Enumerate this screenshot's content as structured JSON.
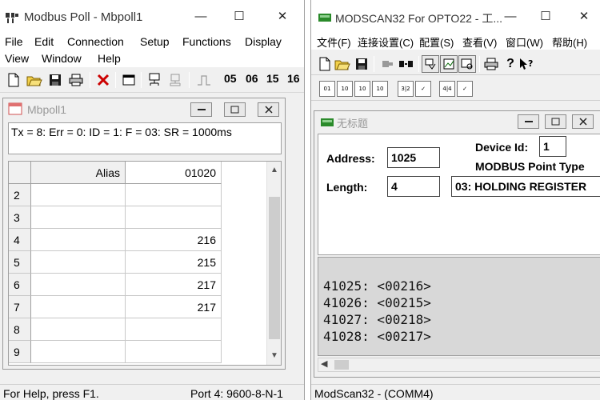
{
  "left": {
    "title": "Modbus Poll - Mbpoll1",
    "caption_buttons": {
      "minimize": "—",
      "maximize": "☐",
      "close": "✕"
    },
    "menu": [
      "File",
      "Edit",
      "Connection",
      "Setup",
      "Functions",
      "Display",
      "View",
      "Window",
      "Help"
    ],
    "toolbar_numbers": [
      "05",
      "06",
      "15",
      "16"
    ],
    "child_title": "Mbpoll1",
    "status_line": "Tx = 8: Err = 0: ID = 1: F = 03: SR = 1000ms",
    "grid": {
      "headers": [
        "",
        "Alias",
        "01020"
      ],
      "rows": [
        {
          "num": "2",
          "alias": "",
          "value": ""
        },
        {
          "num": "3",
          "alias": "",
          "value": ""
        },
        {
          "num": "4",
          "alias": "",
          "value": "216"
        },
        {
          "num": "5",
          "alias": "",
          "value": "215"
        },
        {
          "num": "6",
          "alias": "",
          "value": "217"
        },
        {
          "num": "7",
          "alias": "",
          "value": "217"
        },
        {
          "num": "8",
          "alias": "",
          "value": ""
        },
        {
          "num": "9",
          "alias": "",
          "value": ""
        }
      ]
    },
    "statusbar": {
      "help": "For Help, press F1.",
      "port": "Port 4: 9600-8-N-1"
    }
  },
  "right": {
    "title": "MODSCAN32 For OPTO22 - 工...",
    "caption_buttons": {
      "minimize": "—",
      "maximize": "☐",
      "close": "✕"
    },
    "menu": [
      "文件(F)",
      "连接设置(C)",
      "配置(S)",
      "查看(V)",
      "窗口(W)",
      "帮助(H)"
    ],
    "toolbar2": [
      "01",
      "10",
      "10",
      "10",
      "3|2",
      "✓",
      "4|4",
      "✓"
    ],
    "child_title": "无标题",
    "form": {
      "address_label": "Address:",
      "address_value": "1025",
      "device_id_label": "Device Id:",
      "device_id_value": "1",
      "point_type_label": "MODBUS Point Type",
      "length_label": "Length:",
      "length_value": "4",
      "point_type_value": "03: HOLDING REGISTER"
    },
    "data_lines": [
      "41025: <00216>",
      "41026: <00215>",
      "41027: <00218>",
      "41028: <00217>"
    ],
    "statusbar": "ModScan32 - (COMM4)"
  },
  "colors": {
    "window_bg": "#f0f0f0",
    "data_bg": "#d8d8d8",
    "title_gray": "#999999",
    "red_x": "#cc0000"
  }
}
